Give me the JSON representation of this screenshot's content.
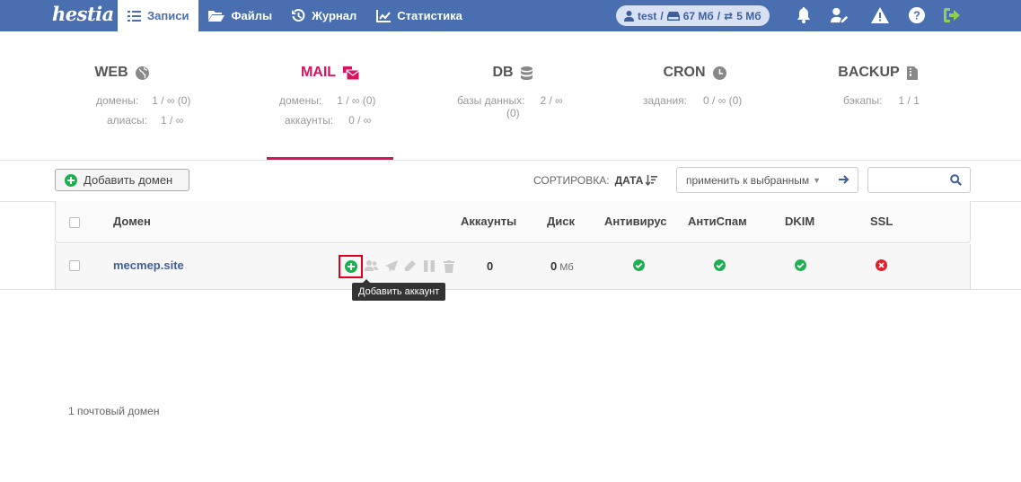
{
  "app": {
    "logo_text": "hestia",
    "nav": [
      {
        "label": "Записи",
        "icon": "list-icon",
        "active": true
      },
      {
        "label": "Файлы",
        "icon": "folder-open-icon",
        "active": false
      },
      {
        "label": "Журнал",
        "icon": "history-icon",
        "active": false
      },
      {
        "label": "Статистика",
        "icon": "chart-line-icon",
        "active": false
      }
    ],
    "user": {
      "name": "test",
      "disk": "67 Мб",
      "bandwidth": "5 Мб"
    },
    "top_icons": [
      "bell-icon",
      "user-cog-icon",
      "warning-icon",
      "help-icon",
      "logout-icon"
    ],
    "colors": {
      "topbar": "#4a6fb0",
      "accent": "#d8125f",
      "success": "#1cb050",
      "danger": "#e0202a",
      "link": "#3f5f9c"
    }
  },
  "stats": [
    {
      "title": "WEB",
      "icon": "globe-icon",
      "rows": [
        {
          "k": "домены:",
          "v": "1 / ∞ (0)"
        },
        {
          "k": "алиасы:",
          "v": "1 / ∞"
        }
      ]
    },
    {
      "title": "MAIL",
      "icon": "mail-bulk-icon",
      "active": true,
      "rows": [
        {
          "k": "домены:",
          "v": "1 / ∞ (0)"
        },
        {
          "k": "аккаунты:",
          "v": "0 / ∞"
        }
      ]
    },
    {
      "title": "DB",
      "icon": "database-icon",
      "rows": [
        {
          "k": "базы данных:",
          "v": "2 / ∞"
        },
        {
          "k": "",
          "v": "(0)"
        }
      ]
    },
    {
      "title": "CRON",
      "icon": "clock-icon",
      "rows": [
        {
          "k": "задания:",
          "v": "0 / ∞ (0)"
        }
      ]
    },
    {
      "title": "BACKUP",
      "icon": "file-archive-icon",
      "rows": [
        {
          "k": "бэкапы:",
          "v": "1 / 1"
        }
      ]
    }
  ],
  "toolbar": {
    "add_domain_label": "Добавить домен",
    "sort_label": "СОРТИРОВКА:",
    "sort_value": "ДАТА",
    "bulk_placeholder": "применить к выбранным",
    "search_value": ""
  },
  "table": {
    "headers": {
      "domain": "Домен",
      "accounts": "Аккаунты",
      "disk": "Диск",
      "antivirus": "Антивирус",
      "antispam": "АнтиСпам",
      "dkim": "DKIM",
      "ssl": "SSL"
    },
    "rows": [
      {
        "domain": "mecmep.site",
        "accounts": "0",
        "disk": "0",
        "disk_unit": "Мб",
        "antivirus": "on",
        "antispam": "on",
        "dkim": "on",
        "ssl": "off"
      }
    ]
  },
  "tooltip": "Добавить аккаунт",
  "footer": {
    "count_text": "1 почтовый домен"
  }
}
